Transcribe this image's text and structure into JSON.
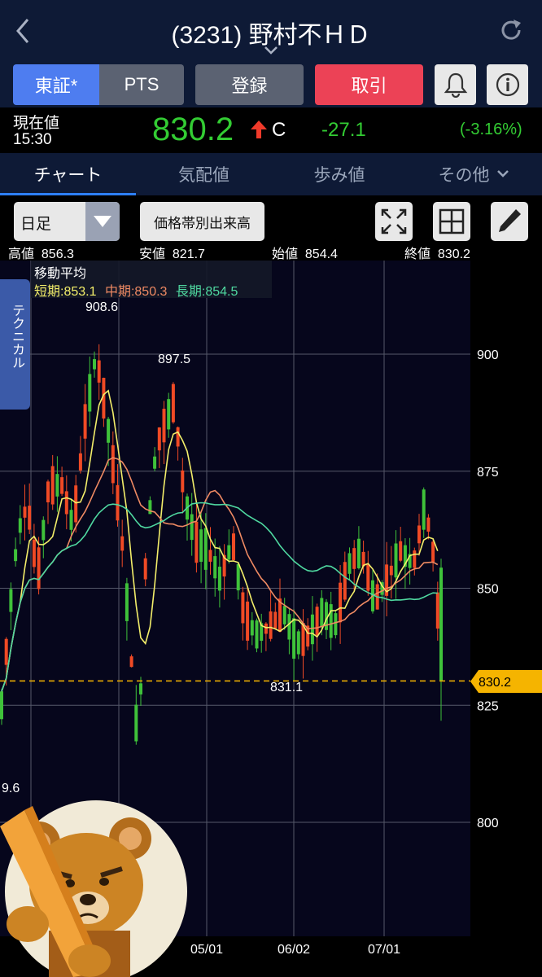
{
  "header": {
    "title": "(3231) 野村不ＨＤ"
  },
  "buttons": {
    "tosho": "東証*",
    "pts": "PTS",
    "register": "登録",
    "trade": "取引"
  },
  "quote": {
    "label": "現在値",
    "time": "15:30",
    "price": "830.2",
    "mark": "C",
    "change": "-27.1",
    "change_pct": "(-3.16%)"
  },
  "tabs": {
    "chart": "チャート",
    "board": "気配値",
    "ticks": "歩み値",
    "other": "その他"
  },
  "toolbar": {
    "period": "日足",
    "volume_profile": "価格帯別出来高"
  },
  "ohlc": {
    "high_label": "高値",
    "high": "856.3",
    "low_label": "安値",
    "low": "821.7",
    "open_label": "始値",
    "open": "854.4",
    "close_label": "終値",
    "close": "830.2"
  },
  "technical_tab": "テクニカル",
  "moving_average": {
    "title": "移動平均",
    "short": "短期:853.1",
    "mid": "中期:850.3",
    "long": "長期:854.5"
  },
  "colors": {
    "up": "#3fc23a",
    "down": "#f04a25",
    "short_ma": "#f3ee6a",
    "mid_ma": "#ef8a63",
    "long_ma": "#4fd8a0",
    "price_line": "#f5b400",
    "trade_button": "#ec4256",
    "tosho_button": "#4e7df0",
    "change_green": "#33cc33"
  },
  "chart_data": {
    "type": "candlestick",
    "price_axis": [
      800,
      825,
      850,
      875,
      900
    ],
    "date_axis": [
      "05/01",
      "06/02",
      "07/01"
    ],
    "current_price": "830.2",
    "annotations": {
      "high_908": "908.6",
      "high_897": "897.5",
      "low_831": "831.1",
      "left_low": "9.6"
    },
    "ylim": [
      780,
      920
    ]
  }
}
